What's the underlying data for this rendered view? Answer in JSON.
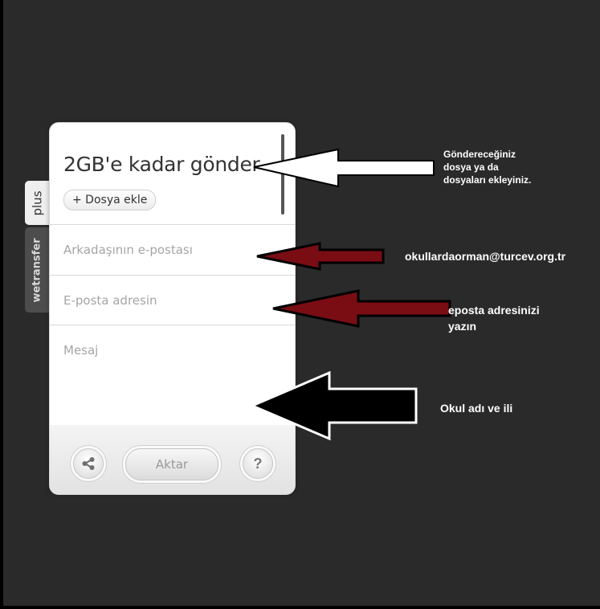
{
  "tabs": {
    "plus_label": "plus",
    "brand_label": "wetransfer"
  },
  "panel": {
    "title": "2GB'e kadar gönder",
    "add_file_label": "+ Dosya ekle",
    "friend_email_placeholder": "Arkadaşının e-postası",
    "your_email_placeholder": "E-posta adresin",
    "message_placeholder": "Mesaj",
    "transfer_label": "Aktar",
    "help_label": "?"
  },
  "icons": {
    "share": "share-icon",
    "help": "question-mark-icon"
  },
  "annotations": {
    "files_note_lines": [
      "Göndereceğiniz",
      "dosya ya da",
      "dosyaları ekleyiniz."
    ],
    "recipient_email": "okullardaorman@turcev.org.tr",
    "sender_note_lines": [
      "eposta adresinizi",
      "yazın"
    ],
    "school_note": "Okul adı ve ili"
  },
  "colors": {
    "background": "#2a2a2a",
    "arrow_white": "#ffffff",
    "arrow_red": "#7a0d14",
    "arrow_black": "#000000"
  }
}
